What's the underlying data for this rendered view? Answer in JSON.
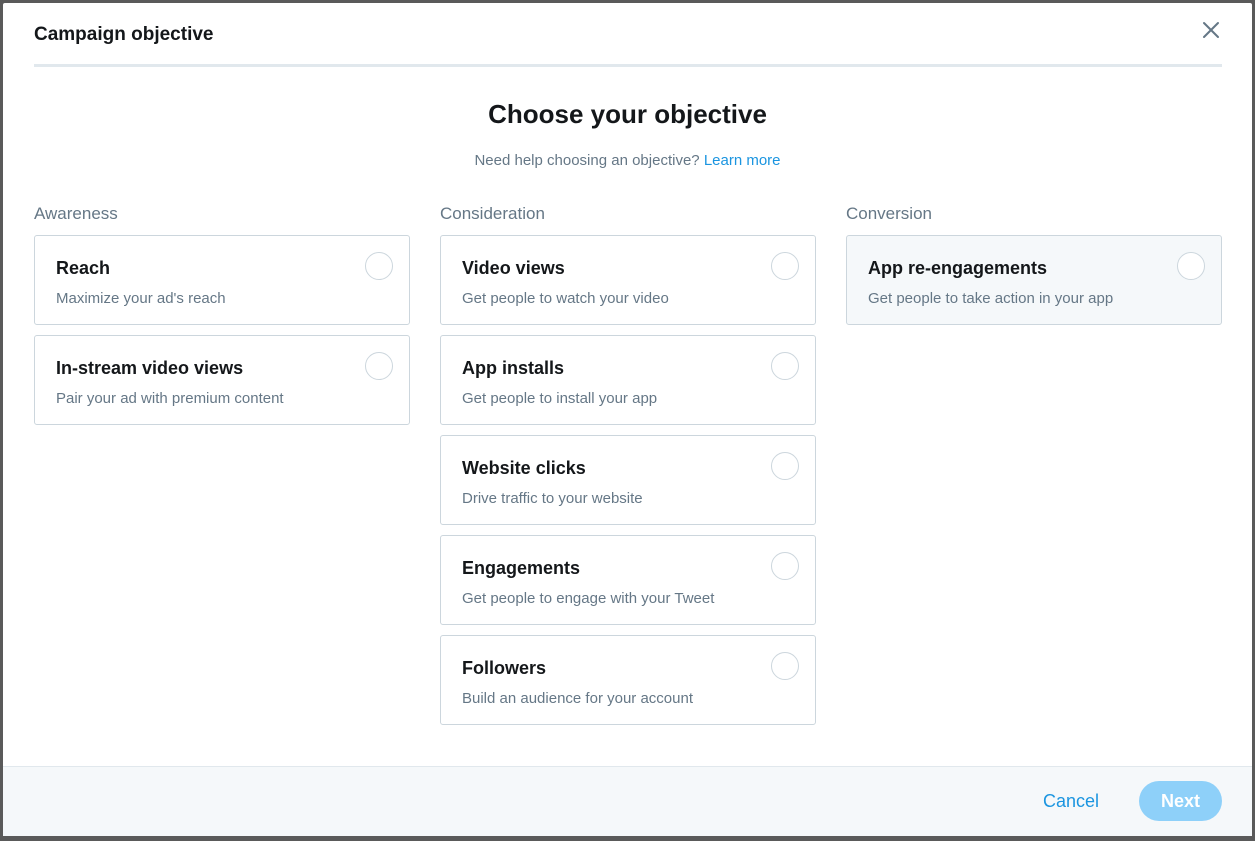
{
  "modal": {
    "title": "Campaign objective",
    "close_icon": "close-icon"
  },
  "headline": "Choose your objective",
  "help": {
    "text": "Need help choosing an objective?",
    "link": "Learn more"
  },
  "columns": [
    {
      "title": "Awareness",
      "options": [
        {
          "title": "Reach",
          "description": "Maximize your ad's reach",
          "selected": false
        },
        {
          "title": "In-stream video views",
          "description": "Pair your ad with premium content",
          "selected": false
        }
      ]
    },
    {
      "title": "Consideration",
      "options": [
        {
          "title": "Video views",
          "description": "Get people to watch your video",
          "selected": false
        },
        {
          "title": "App installs",
          "description": "Get people to install your app",
          "selected": false
        },
        {
          "title": "Website clicks",
          "description": "Drive traffic to your website",
          "selected": false
        },
        {
          "title": "Engagements",
          "description": "Get people to engage with your Tweet",
          "selected": false
        },
        {
          "title": "Followers",
          "description": "Build an audience for your account",
          "selected": false
        }
      ]
    },
    {
      "title": "Conversion",
      "options": [
        {
          "title": "App re-engagements",
          "description": "Get people to take action in your app",
          "selected": false
        }
      ]
    }
  ],
  "footer": {
    "cancel_label": "Cancel",
    "next_label": "Next",
    "next_enabled": false
  },
  "colors": {
    "accent": "#1b95e0",
    "next_disabled": "#8ed0f9",
    "border": "#ccd6dd",
    "muted_text": "#657786"
  }
}
